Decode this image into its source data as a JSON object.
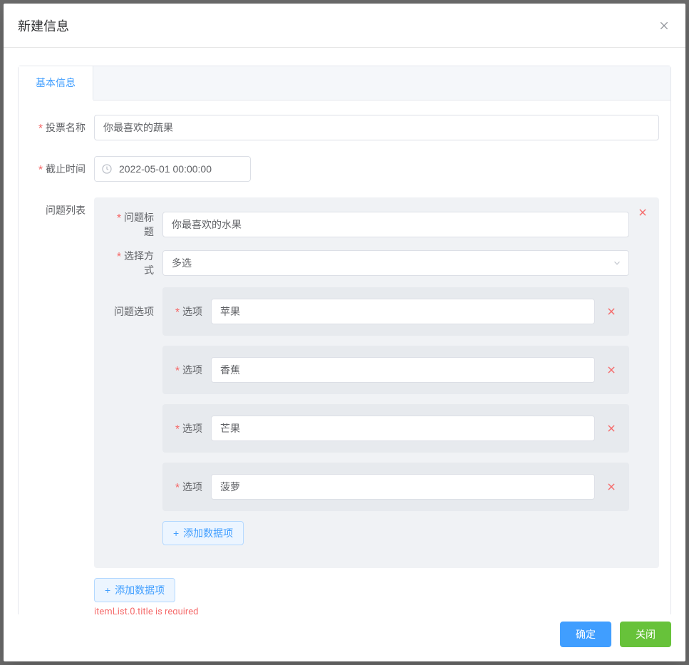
{
  "dialog": {
    "title": "新建信息"
  },
  "tab": {
    "basic": "基本信息"
  },
  "labels": {
    "vote_name": "投票名称",
    "deadline": "截止时间",
    "question_list": "问题列表",
    "question_title": "问题标题",
    "select_mode": "选择方式",
    "question_options": "问题选项",
    "option": "选项"
  },
  "form": {
    "vote_name": "你最喜欢的蔬果",
    "deadline": "2022-05-01 00:00:00",
    "question": {
      "title": "你最喜欢的水果",
      "select_mode": "多选",
      "options": [
        "苹果",
        "香蕉",
        "芒果",
        "菠萝"
      ]
    }
  },
  "buttons": {
    "add_item": "添加数据项",
    "confirm": "确定",
    "close": "关闭"
  },
  "error": "itemList.0.title is required"
}
